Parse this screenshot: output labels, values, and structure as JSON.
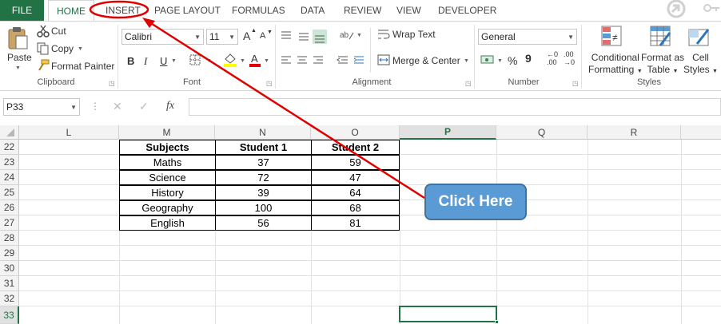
{
  "tabs": {
    "file": "FILE",
    "items": [
      "HOME",
      "INSERT",
      "PAGE LAYOUT",
      "FORMULAS",
      "DATA",
      "REVIEW",
      "VIEW",
      "DEVELOPER"
    ]
  },
  "ribbon": {
    "clipboard": {
      "paste": "Paste",
      "cut": "Cut",
      "copy": "Copy",
      "format_painter": "Format Painter",
      "label": "Clipboard"
    },
    "font": {
      "font_name": "Calibri",
      "font_size": "11",
      "bold": "B",
      "italic": "I",
      "underline": "U",
      "grow": "A",
      "shrink": "A",
      "label": "Font"
    },
    "alignment": {
      "wrap_text": "Wrap Text",
      "merge_center": "Merge & Center",
      "label": "Alignment"
    },
    "number": {
      "format": "General",
      "percent": "%",
      "comma": "9",
      "inc_decimal_a": "←0",
      "inc_decimal_b": ".00",
      "dec_decimal_a": ".00",
      "dec_decimal_b": "→0",
      "label": "Number"
    },
    "styles": {
      "conditional_1": "Conditional",
      "conditional_2": "Formatting",
      "format_as_1": "Format as",
      "format_as_2": "Table",
      "cell_styles_1": "Cell",
      "cell_styles_2": "Styles",
      "label": "Styles"
    }
  },
  "formula_bar": {
    "name_box": "P33",
    "fx": "fx",
    "value": ""
  },
  "columns": [
    "L",
    "M",
    "N",
    "O",
    "P",
    "Q",
    "R"
  ],
  "selected_column": "P",
  "rows": [
    "22",
    "23",
    "24",
    "25",
    "26",
    "27",
    "28",
    "29",
    "30",
    "31",
    "32",
    "33"
  ],
  "selected_row": "33",
  "table": {
    "headers": [
      "Subjects",
      "Student 1",
      "Student 2"
    ],
    "rows": [
      [
        "Maths",
        "37",
        "59"
      ],
      [
        "Science",
        "72",
        "47"
      ],
      [
        "History",
        "39",
        "64"
      ],
      [
        "Geography",
        "100",
        "68"
      ],
      [
        "English",
        "56",
        "81"
      ]
    ]
  },
  "callout": {
    "text": "Click Here",
    "fill": "#5b9bd5"
  },
  "annotation": {
    "color": "#e00000",
    "target_tab": "INSERT"
  },
  "colors": {
    "file_tab": "#217346",
    "accent": "#217346"
  }
}
